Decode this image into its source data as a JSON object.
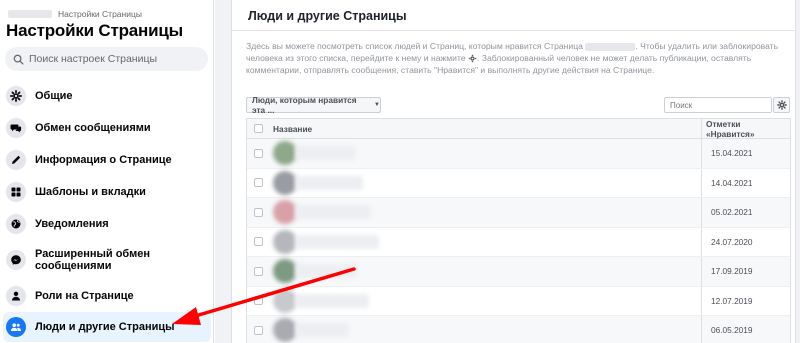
{
  "sidebar": {
    "breadcrumb": "Настройки Страницы",
    "title": "Настройки Страницы",
    "search_placeholder": "Поиск настроек Страницы",
    "items": [
      {
        "label": "Общие",
        "icon": "gear-icon"
      },
      {
        "label": "Обмен сообщениями",
        "icon": "chat-icon"
      },
      {
        "label": "Информация о Странице",
        "icon": "pencil-icon"
      },
      {
        "label": "Шаблоны и вкладки",
        "icon": "grid-icon"
      },
      {
        "label": "Уведомления",
        "icon": "globe-icon"
      },
      {
        "label": "Расширенный обмен сообщениями",
        "icon": "messenger-icon"
      },
      {
        "label": "Роли на Странице",
        "icon": "person-icon"
      },
      {
        "label": "Люди и другие Страницы",
        "icon": "people-icon",
        "active": true
      }
    ]
  },
  "main": {
    "title": "Люди и другие Страницы",
    "description_part1": "Здесь вы можете посмотреть список людей и Страниц, которым нравится Страница",
    "description_part2": ". Чтобы удалить или заблокировать человека из этого списка, перейдите к нему и нажмите",
    "description_part3": ". Заблокированный человек не может делать публикации, оставлять комментарии, отправлять сообщения, ставить \"Нравится\" и выполнять другие действия на Странице.",
    "filter_label": "Люди, которым нравится эта ...",
    "table_search_placeholder": "Поиск",
    "columns": {
      "name": "Название",
      "date": "Отметки «Нравится»"
    },
    "rows": [
      {
        "date": "15.04.2021",
        "avatar_color": "#8fa88a",
        "name_width": 60
      },
      {
        "date": "14.04.2021",
        "avatar_color": "#9a9ca3",
        "name_width": 68
      },
      {
        "date": "05.02.2021",
        "avatar_color": "#d9a0a8",
        "name_width": 76
      },
      {
        "date": "24.07.2020",
        "avatar_color": "#b5b7bc",
        "name_width": 84
      },
      {
        "date": "17.09.2019",
        "avatar_color": "#7f9a82",
        "name_width": 62
      },
      {
        "date": "12.07.2019",
        "avatar_color": "#c7c9cd",
        "name_width": 74
      },
      {
        "date": "06.05.2019",
        "avatar_color": "#a9abb1",
        "name_width": 54
      }
    ]
  },
  "colors": {
    "accent": "#1877f2",
    "arrow": "#ff0000"
  }
}
